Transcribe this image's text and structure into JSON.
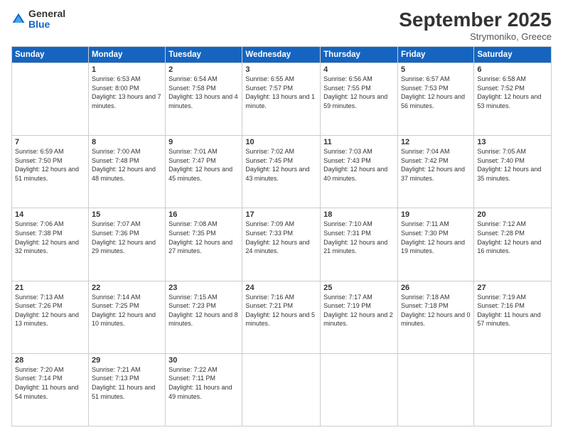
{
  "logo": {
    "general": "General",
    "blue": "Blue"
  },
  "header": {
    "month": "September 2025",
    "location": "Strymoniko, Greece"
  },
  "weekdays": [
    "Sunday",
    "Monday",
    "Tuesday",
    "Wednesday",
    "Thursday",
    "Friday",
    "Saturday"
  ],
  "weeks": [
    [
      {
        "day": "",
        "sunrise": "",
        "sunset": "",
        "daylight": ""
      },
      {
        "day": "1",
        "sunrise": "Sunrise: 6:53 AM",
        "sunset": "Sunset: 8:00 PM",
        "daylight": "Daylight: 13 hours and 7 minutes."
      },
      {
        "day": "2",
        "sunrise": "Sunrise: 6:54 AM",
        "sunset": "Sunset: 7:58 PM",
        "daylight": "Daylight: 13 hours and 4 minutes."
      },
      {
        "day": "3",
        "sunrise": "Sunrise: 6:55 AM",
        "sunset": "Sunset: 7:57 PM",
        "daylight": "Daylight: 13 hours and 1 minute."
      },
      {
        "day": "4",
        "sunrise": "Sunrise: 6:56 AM",
        "sunset": "Sunset: 7:55 PM",
        "daylight": "Daylight: 12 hours and 59 minutes."
      },
      {
        "day": "5",
        "sunrise": "Sunrise: 6:57 AM",
        "sunset": "Sunset: 7:53 PM",
        "daylight": "Daylight: 12 hours and 56 minutes."
      },
      {
        "day": "6",
        "sunrise": "Sunrise: 6:58 AM",
        "sunset": "Sunset: 7:52 PM",
        "daylight": "Daylight: 12 hours and 53 minutes."
      }
    ],
    [
      {
        "day": "7",
        "sunrise": "Sunrise: 6:59 AM",
        "sunset": "Sunset: 7:50 PM",
        "daylight": "Daylight: 12 hours and 51 minutes."
      },
      {
        "day": "8",
        "sunrise": "Sunrise: 7:00 AM",
        "sunset": "Sunset: 7:48 PM",
        "daylight": "Daylight: 12 hours and 48 minutes."
      },
      {
        "day": "9",
        "sunrise": "Sunrise: 7:01 AM",
        "sunset": "Sunset: 7:47 PM",
        "daylight": "Daylight: 12 hours and 45 minutes."
      },
      {
        "day": "10",
        "sunrise": "Sunrise: 7:02 AM",
        "sunset": "Sunset: 7:45 PM",
        "daylight": "Daylight: 12 hours and 43 minutes."
      },
      {
        "day": "11",
        "sunrise": "Sunrise: 7:03 AM",
        "sunset": "Sunset: 7:43 PM",
        "daylight": "Daylight: 12 hours and 40 minutes."
      },
      {
        "day": "12",
        "sunrise": "Sunrise: 7:04 AM",
        "sunset": "Sunset: 7:42 PM",
        "daylight": "Daylight: 12 hours and 37 minutes."
      },
      {
        "day": "13",
        "sunrise": "Sunrise: 7:05 AM",
        "sunset": "Sunset: 7:40 PM",
        "daylight": "Daylight: 12 hours and 35 minutes."
      }
    ],
    [
      {
        "day": "14",
        "sunrise": "Sunrise: 7:06 AM",
        "sunset": "Sunset: 7:38 PM",
        "daylight": "Daylight: 12 hours and 32 minutes."
      },
      {
        "day": "15",
        "sunrise": "Sunrise: 7:07 AM",
        "sunset": "Sunset: 7:36 PM",
        "daylight": "Daylight: 12 hours and 29 minutes."
      },
      {
        "day": "16",
        "sunrise": "Sunrise: 7:08 AM",
        "sunset": "Sunset: 7:35 PM",
        "daylight": "Daylight: 12 hours and 27 minutes."
      },
      {
        "day": "17",
        "sunrise": "Sunrise: 7:09 AM",
        "sunset": "Sunset: 7:33 PM",
        "daylight": "Daylight: 12 hours and 24 minutes."
      },
      {
        "day": "18",
        "sunrise": "Sunrise: 7:10 AM",
        "sunset": "Sunset: 7:31 PM",
        "daylight": "Daylight: 12 hours and 21 minutes."
      },
      {
        "day": "19",
        "sunrise": "Sunrise: 7:11 AM",
        "sunset": "Sunset: 7:30 PM",
        "daylight": "Daylight: 12 hours and 19 minutes."
      },
      {
        "day": "20",
        "sunrise": "Sunrise: 7:12 AM",
        "sunset": "Sunset: 7:28 PM",
        "daylight": "Daylight: 12 hours and 16 minutes."
      }
    ],
    [
      {
        "day": "21",
        "sunrise": "Sunrise: 7:13 AM",
        "sunset": "Sunset: 7:26 PM",
        "daylight": "Daylight: 12 hours and 13 minutes."
      },
      {
        "day": "22",
        "sunrise": "Sunrise: 7:14 AM",
        "sunset": "Sunset: 7:25 PM",
        "daylight": "Daylight: 12 hours and 10 minutes."
      },
      {
        "day": "23",
        "sunrise": "Sunrise: 7:15 AM",
        "sunset": "Sunset: 7:23 PM",
        "daylight": "Daylight: 12 hours and 8 minutes."
      },
      {
        "day": "24",
        "sunrise": "Sunrise: 7:16 AM",
        "sunset": "Sunset: 7:21 PM",
        "daylight": "Daylight: 12 hours and 5 minutes."
      },
      {
        "day": "25",
        "sunrise": "Sunrise: 7:17 AM",
        "sunset": "Sunset: 7:19 PM",
        "daylight": "Daylight: 12 hours and 2 minutes."
      },
      {
        "day": "26",
        "sunrise": "Sunrise: 7:18 AM",
        "sunset": "Sunset: 7:18 PM",
        "daylight": "Daylight: 12 hours and 0 minutes."
      },
      {
        "day": "27",
        "sunrise": "Sunrise: 7:19 AM",
        "sunset": "Sunset: 7:16 PM",
        "daylight": "Daylight: 11 hours and 57 minutes."
      }
    ],
    [
      {
        "day": "28",
        "sunrise": "Sunrise: 7:20 AM",
        "sunset": "Sunset: 7:14 PM",
        "daylight": "Daylight: 11 hours and 54 minutes."
      },
      {
        "day": "29",
        "sunrise": "Sunrise: 7:21 AM",
        "sunset": "Sunset: 7:13 PM",
        "daylight": "Daylight: 11 hours and 51 minutes."
      },
      {
        "day": "30",
        "sunrise": "Sunrise: 7:22 AM",
        "sunset": "Sunset: 7:11 PM",
        "daylight": "Daylight: 11 hours and 49 minutes."
      },
      {
        "day": "",
        "sunrise": "",
        "sunset": "",
        "daylight": ""
      },
      {
        "day": "",
        "sunrise": "",
        "sunset": "",
        "daylight": ""
      },
      {
        "day": "",
        "sunrise": "",
        "sunset": "",
        "daylight": ""
      },
      {
        "day": "",
        "sunrise": "",
        "sunset": "",
        "daylight": ""
      }
    ]
  ]
}
